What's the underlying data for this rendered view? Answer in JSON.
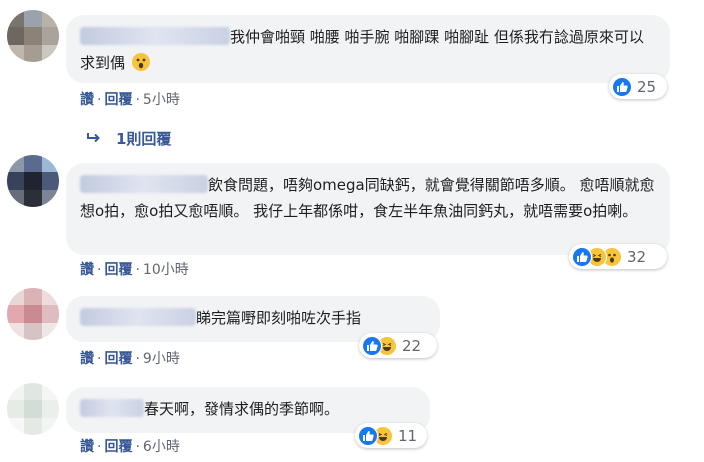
{
  "comments": [
    {
      "text": "我仲會啪頸 啪腰 啪手腕 啪腳踝 啪腳趾 但係我冇諗過原來可以求到偶",
      "like_label": "讚",
      "reply_label": "回覆",
      "time": "5小時",
      "reaction_count": "25",
      "reactions": [
        "like-icon"
      ]
    },
    {
      "text": "飲食問題，唔夠omega同缺鈣，就會覺得關節唔多順。 愈唔順就愈想o拍，愈o拍又愈唔順。 我仔上年都係咁，食左半年魚油同鈣丸，就唔需要o拍喇。",
      "like_label": "讚",
      "reply_label": "回覆",
      "time": "10小時",
      "reaction_count": "32",
      "reactions": [
        "like-icon",
        "haha-icon",
        "wow-icon"
      ]
    },
    {
      "text": "睇完篇嘢即刻啪咗次手指",
      "like_label": "讚",
      "reply_label": "回覆",
      "time": "9小時",
      "reaction_count": "22",
      "reactions": [
        "like-icon",
        "haha-icon"
      ]
    },
    {
      "text": "春天啊，發情求偶的季節啊。",
      "like_label": "讚",
      "reply_label": "回覆",
      "time": "6小時",
      "reaction_count": "11",
      "reactions": [
        "like-icon",
        "haha-icon"
      ]
    }
  ],
  "replies_link": "1則回覆",
  "separator": "·",
  "icons": [
    "reply-arrow-icon",
    "like-icon",
    "haha-icon",
    "wow-icon"
  ],
  "colors": {
    "link": "#385898",
    "bubble": "#f2f3f5",
    "like": "#1877f2",
    "emoji": "#f7c43b"
  }
}
